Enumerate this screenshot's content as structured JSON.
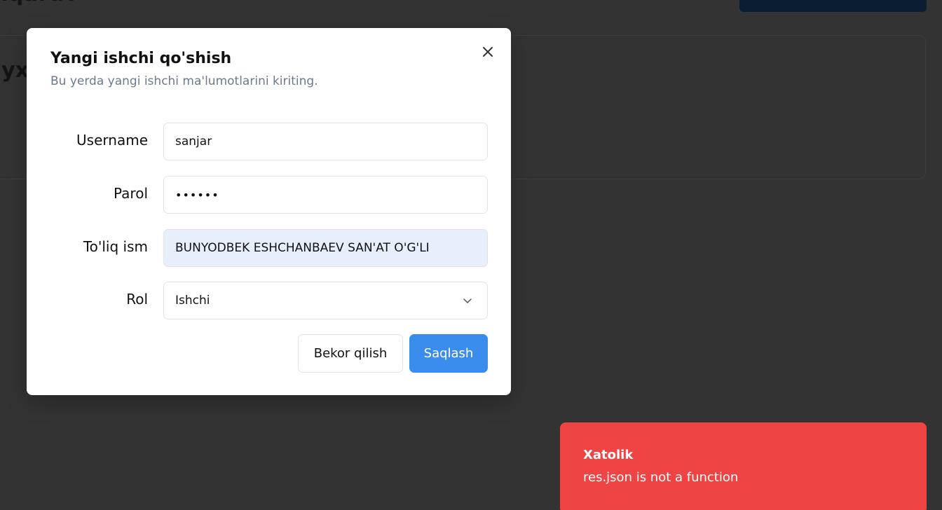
{
  "background": {
    "header_title_fragment": "nqaruv",
    "card_text_fragment": "'yx"
  },
  "modal": {
    "title": "Yangi ishchi qo'shish",
    "subtitle": "Bu yerda yangi ishchi ma'lumotlarini kiriting.",
    "close_icon": "close-icon",
    "fields": {
      "username": {
        "label": "Username",
        "value": "sanjar"
      },
      "password": {
        "label": "Parol",
        "value": "••••••"
      },
      "full_name": {
        "label": "To'liq ism",
        "value": "BUNYODBEK ESHCHANBAEV SAN'AT O'G'LI"
      },
      "role": {
        "label": "Rol",
        "value": "Ishchi",
        "icon": "chevron-down-icon"
      }
    },
    "buttons": {
      "cancel": "Bekor qilish",
      "save": "Saqlash"
    }
  },
  "toast": {
    "title": "Xatolik",
    "message": "res.json is not a function"
  },
  "colors": {
    "overlay": "#333333",
    "primary": "#3b8ded",
    "error": "#ef4444",
    "autofill": "#e8effc"
  }
}
